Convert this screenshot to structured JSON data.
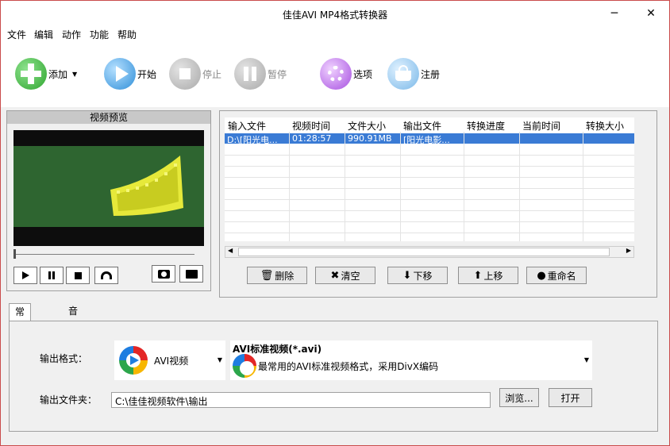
{
  "window": {
    "title": "佳佳AVI MP4格式转换器",
    "minimize": "─",
    "close": "✕"
  },
  "menu": [
    "文件",
    "编辑",
    "动作",
    "功能",
    "帮助"
  ],
  "toolbar": {
    "add": "添加",
    "start": "开始",
    "stop": "停止",
    "pause": "暂停",
    "options": "选项",
    "register": "注册"
  },
  "preview": {
    "title": "视频预览"
  },
  "filelist": {
    "columns": [
      "输入文件",
      "视频时间",
      "文件大小",
      "输出文件",
      "转换进度",
      "当前时间",
      "转换大小"
    ],
    "rows": [
      {
        "input": "D:\\[阳光电...",
        "duration": "01:28:57",
        "size": "990.91MB",
        "output": "[阳光电影...",
        "progress": "",
        "current": "",
        "converted": ""
      }
    ]
  },
  "actions": {
    "delete": "删除",
    "clear": "清空",
    "down": "下移",
    "up": "上移",
    "rename": "重命名"
  },
  "tabs": {
    "general": "常规设置",
    "advanced": "音视频高级设置"
  },
  "settings": {
    "format_label": "输出格式：",
    "format_value": "AVI视频",
    "profile_title": "AVI标准视频(*.avi)",
    "profile_desc": "最常用的AVI标准视频格式，采用DivX编码",
    "folder_label": "输出文件夹：",
    "folder_value": "C:\\佳佳视频软件\\输出",
    "browse": "浏览...",
    "open": "打开"
  },
  "colors": {
    "selection": "#3a7bd5",
    "scene": "#2e6530",
    "border": "#c94c4c"
  }
}
